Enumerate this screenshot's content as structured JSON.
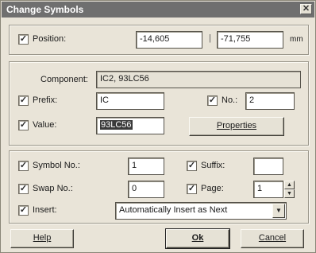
{
  "window": {
    "title": "Change Symbols",
    "close_glyph": "✕"
  },
  "position": {
    "label": "Position:",
    "checked": true,
    "x": "-14,605",
    "separator": "|",
    "y": "-71,755",
    "unit": "mm"
  },
  "component": {
    "label": "Component:",
    "value": "IC2, 93LC56"
  },
  "prefix": {
    "label": "Prefix:",
    "checked": true,
    "value": "IC"
  },
  "number": {
    "label": "No.:",
    "checked": true,
    "value": "2"
  },
  "value": {
    "label": "Value:",
    "checked": true,
    "value": "93LC56"
  },
  "properties_button": {
    "label": "Properties"
  },
  "symbol_no": {
    "label": "Symbol No.:",
    "checked": true,
    "value": "1"
  },
  "suffix": {
    "label": "Suffix:",
    "checked": true,
    "value": ""
  },
  "swap_no": {
    "label": "Swap No.:",
    "checked": true,
    "value": "0"
  },
  "page": {
    "label": "Page:",
    "checked": true,
    "value": "1"
  },
  "insert": {
    "label": "Insert:",
    "checked": true,
    "value": "Automatically Insert as Next"
  },
  "buttons": {
    "help": "Help",
    "ok": "Ok",
    "cancel": "Cancel"
  },
  "glyphs": {
    "check": "✓",
    "spin_up": "▲",
    "spin_down": "▼",
    "dropdown": "▼"
  }
}
